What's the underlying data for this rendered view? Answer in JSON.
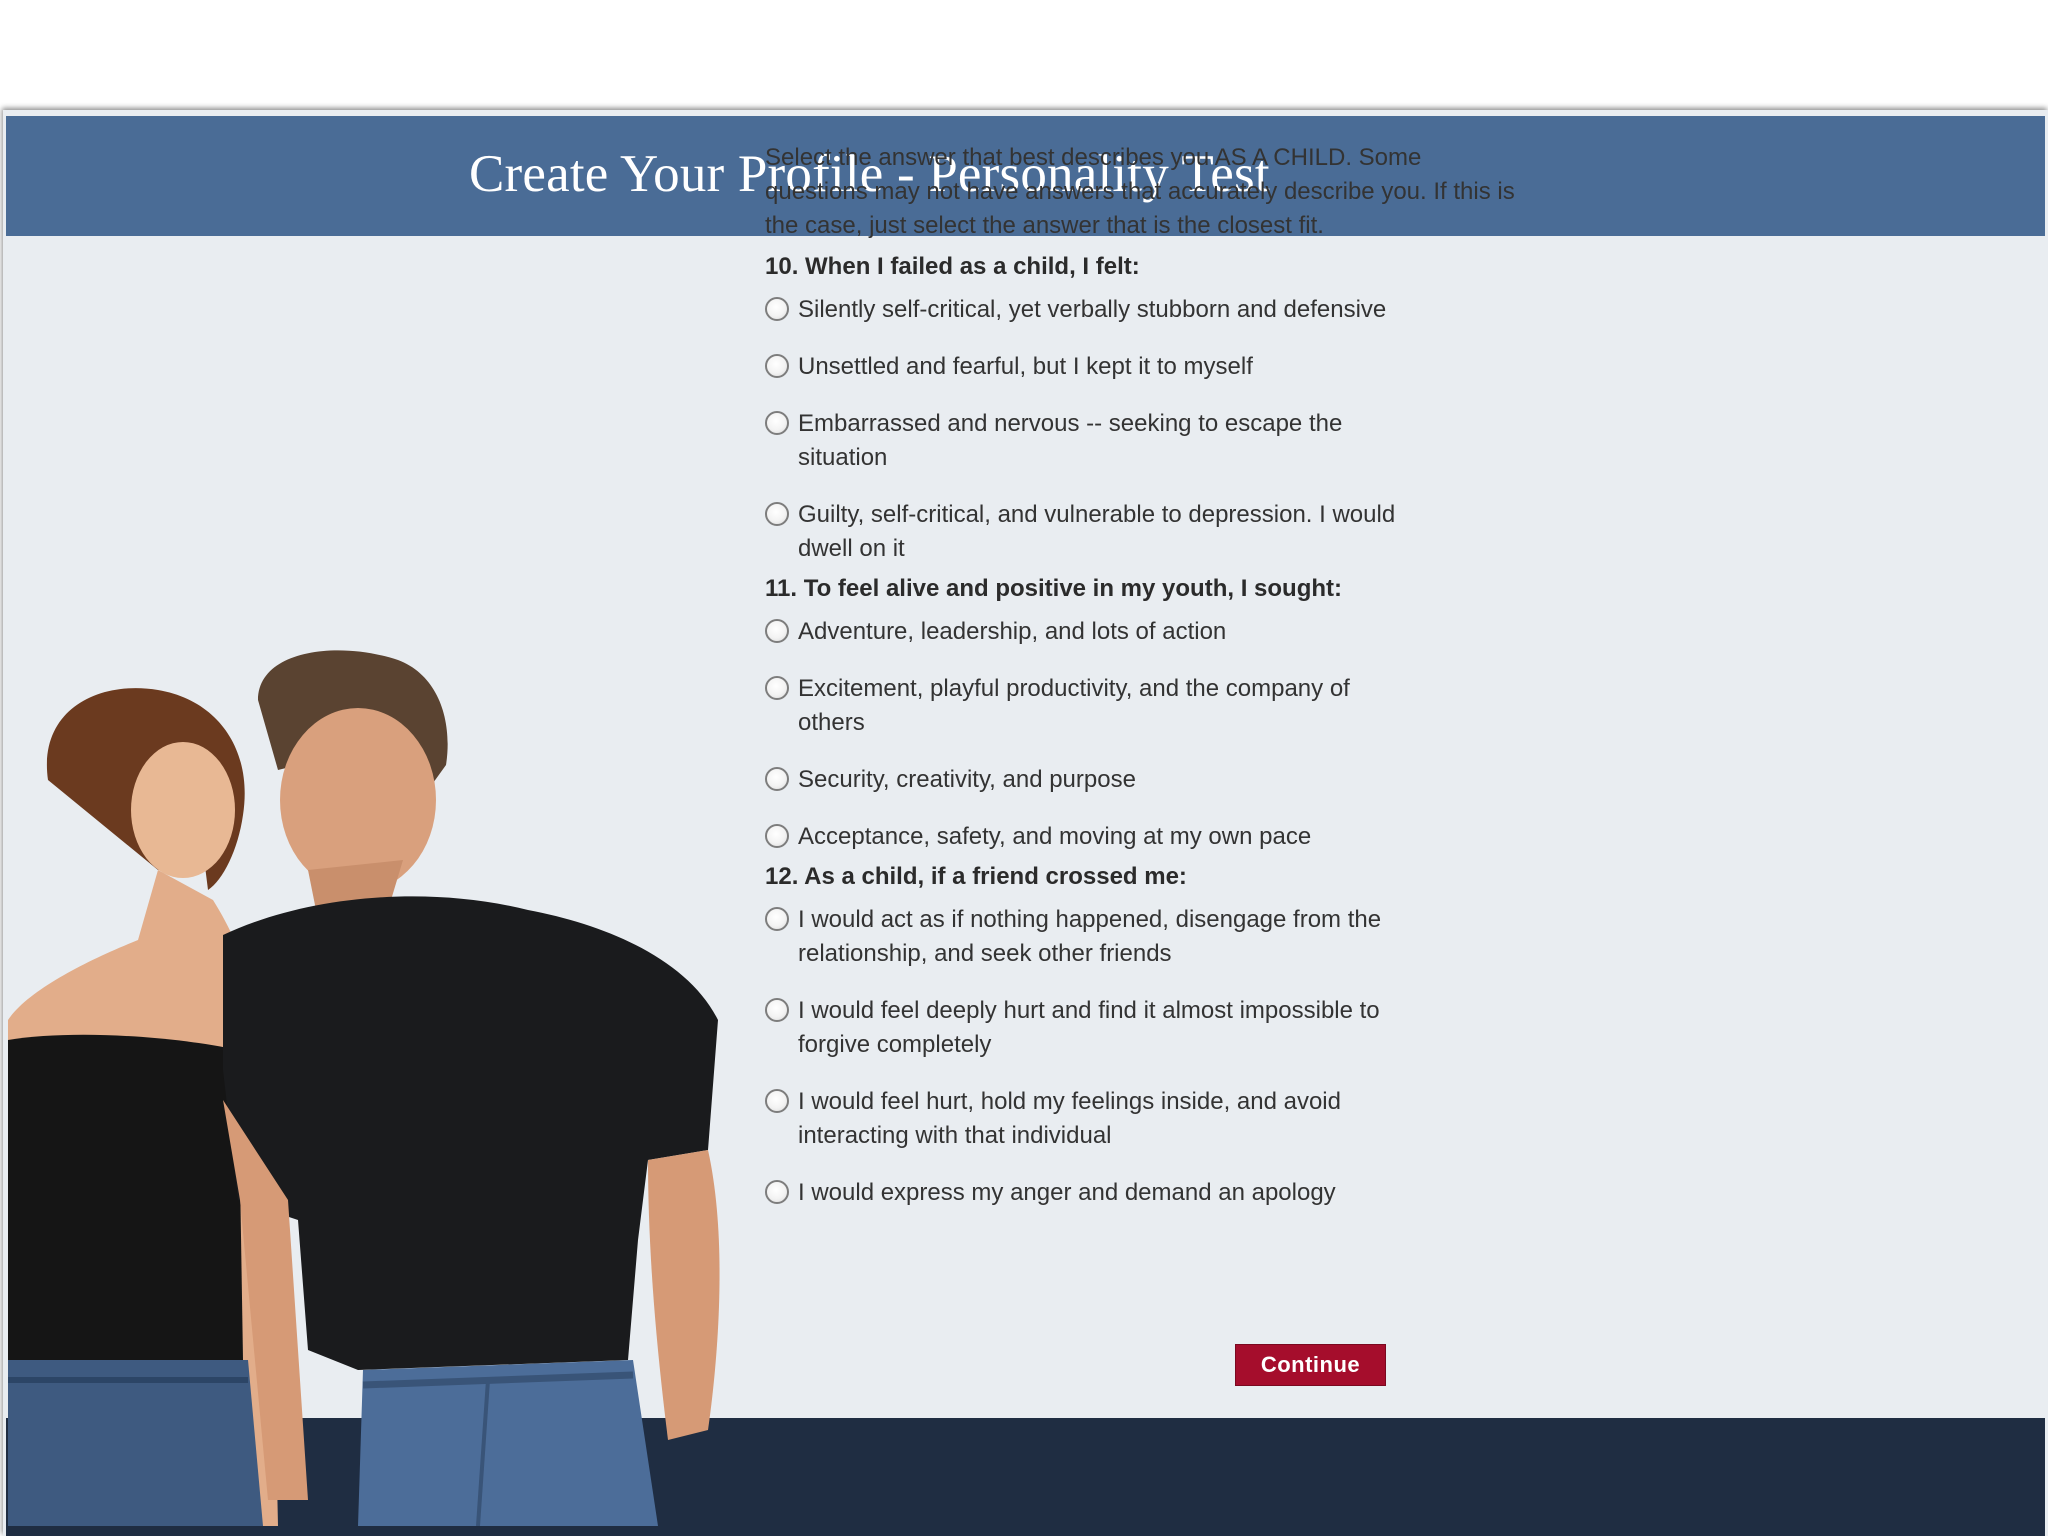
{
  "header": {
    "title": "Create Your Profile - Personality Test"
  },
  "intro_text": "Select the answer that best describes you AS A CHILD. Some questions may not have answers that accurately describe you. If this is the case, just select the answer that is the closest fit.",
  "questions": [
    {
      "label": "10. When I failed as a child, I felt:",
      "options": [
        "Silently self-critical, yet verbally stubborn and defensive",
        "Unsettled and fearful, but I kept it to myself",
        "Embarrassed and nervous -- seeking to escape the situation",
        "Guilty, self-critical, and vulnerable to depression. I would dwell on it"
      ]
    },
    {
      "label": "11. To feel alive and positive in my youth, I sought:",
      "options": [
        "Adventure, leadership, and lots of action",
        "Excitement, playful productivity, and the company of others",
        "Security, creativity, and purpose",
        "Acceptance, safety, and moving at my own pace"
      ]
    },
    {
      "label": "12. As a child, if a friend crossed me:",
      "options": [
        "I would act as if nothing happened, disengage from the relationship, and seek other friends",
        "I would feel deeply hurt and find it almost impossible to forgive completely",
        "I would feel hurt, hold my feelings inside, and avoid interacting with that individual",
        "I would express my anger and demand an apology"
      ]
    }
  ],
  "continue_label": "Continue",
  "colors": {
    "header_bg": "#4a6c96",
    "content_bg": "#e9edf1",
    "footer_bg": "#1f2d42",
    "button_bg": "#a50d2c"
  }
}
